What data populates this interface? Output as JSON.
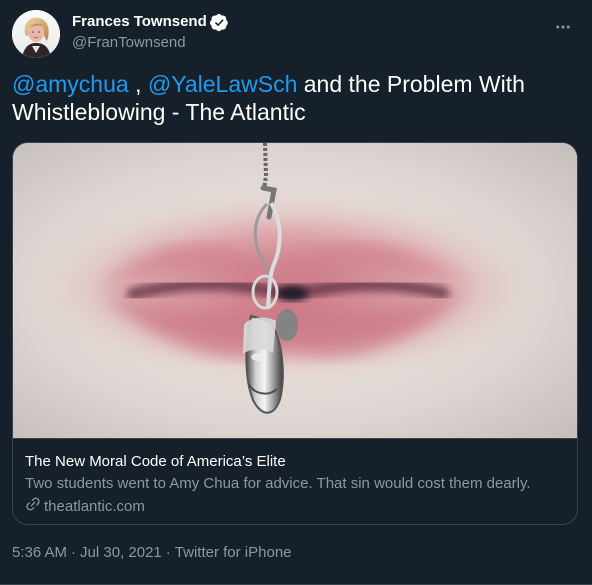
{
  "author": {
    "name": "Frances Townsend",
    "handle": "@FranTownsend",
    "verified": true,
    "avatar_icon": "profile-photo"
  },
  "tweet": {
    "mention_1": "@amychua",
    "text_1": " , ",
    "mention_2": "@YaleLawSch",
    "text_2": " and the Problem With Whistleblowing - The Atlantic"
  },
  "card": {
    "title": "The New Moral Code of America’s Elite",
    "description": "Two students went to Amy Chua for advice. That sin would cost them dearly.",
    "domain": "theatlantic.com",
    "domain_icon": "link-icon"
  },
  "meta": {
    "time": "5:36 AM",
    "separator_1": "·",
    "date": "Jul 30, 2021",
    "separator_2": "·",
    "source": "Twitter for iPhone"
  },
  "ui": {
    "more_icon": "more-options-icon",
    "colors": {
      "background": "#15202b",
      "text": "#ffffff",
      "secondary": "#8b98a5",
      "accent": "#1d9bf0",
      "border": "#38444d"
    }
  }
}
